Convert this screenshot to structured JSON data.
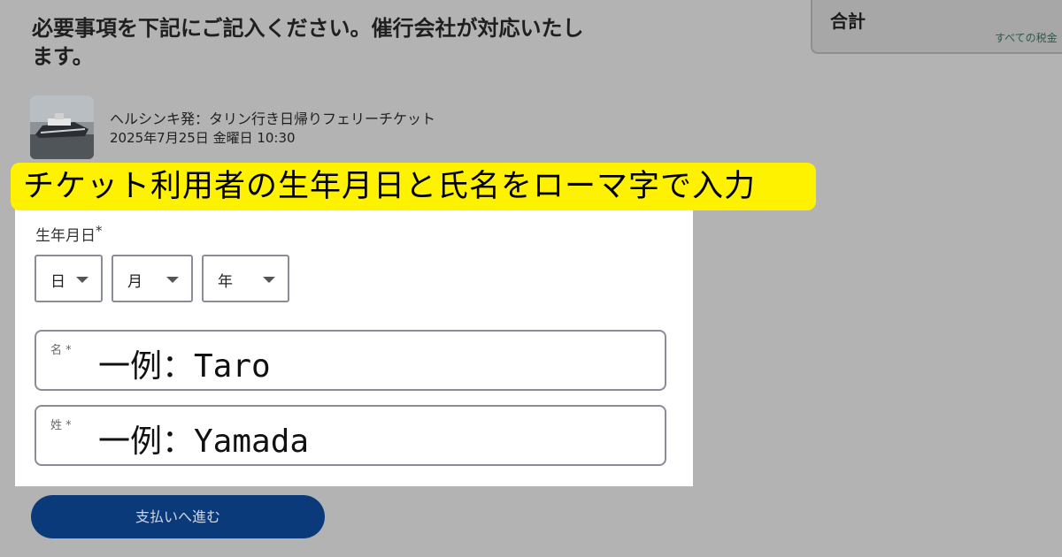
{
  "heading": "必要事項を下記にご記入ください。催行会社が対応いたします。",
  "summary": {
    "title": "合計",
    "note": "すべての税金"
  },
  "product": {
    "title": "ヘルシンキ発：タリン行き日帰りフェリーチケット",
    "date": "2025年7月25日 金曜日 10:30"
  },
  "banner": "チケット利用者の生年月日と氏名をローマ字で入力",
  "dob": {
    "label": "生年月日",
    "required_mark": "*",
    "day": "日",
    "month": "月",
    "year": "年"
  },
  "first_name": {
    "label": "名 *",
    "placeholder": "一例：Taro"
  },
  "last_name": {
    "label": "姓 *",
    "placeholder": "一例：Yamada"
  },
  "submit_label": "支払いへ進む",
  "colors": {
    "overlay_bg": "#b3b3b3",
    "banner": "#fff200",
    "primary_button": "#0b3a7a"
  }
}
